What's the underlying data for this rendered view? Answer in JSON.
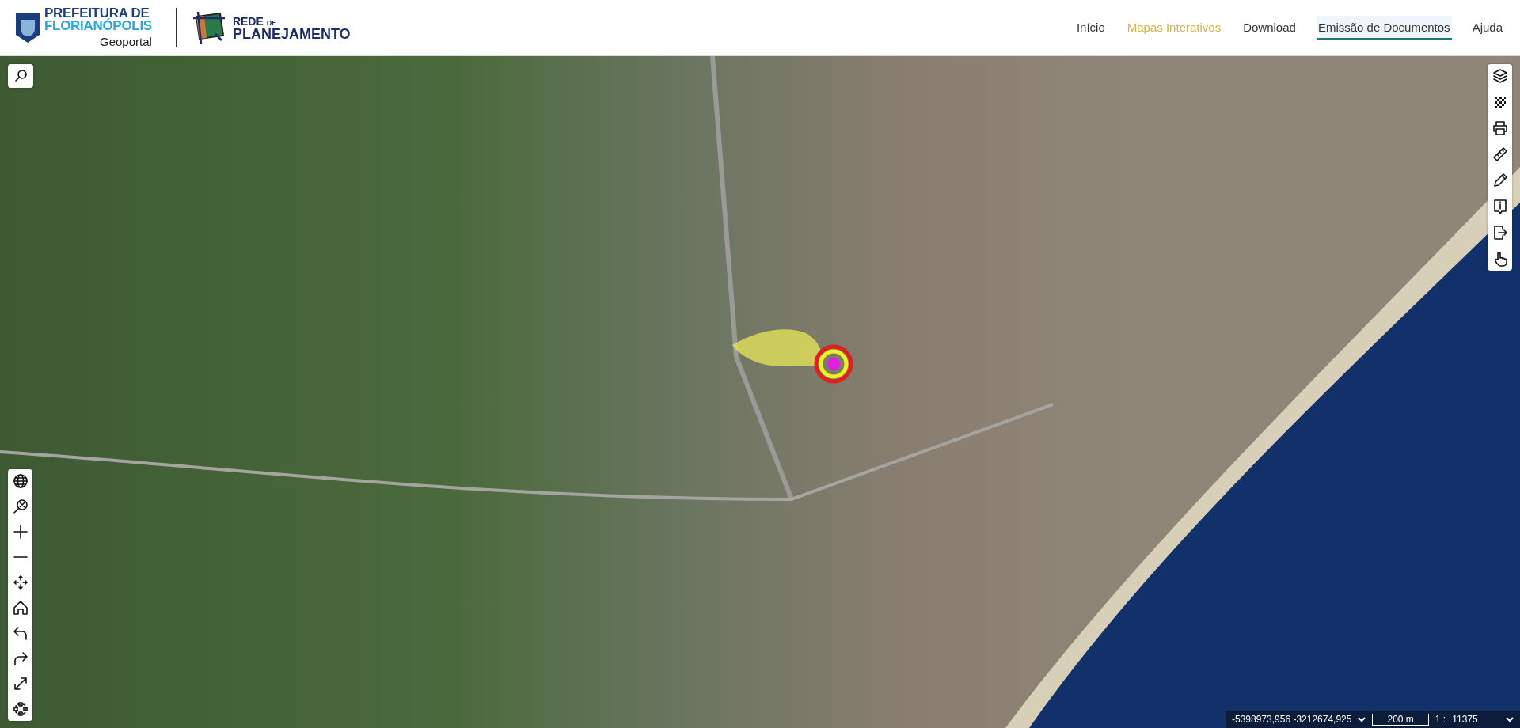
{
  "header": {
    "brand": {
      "line_1": "PREFEITURA DE",
      "line_2": "FLORIANÓPOLIS",
      "subtitle": "Geoportal"
    },
    "partner": {
      "line_1": "REDE",
      "line_1_small": "DE",
      "line_2": "PLANEJAMENTO"
    },
    "nav": [
      {
        "label": "Início",
        "selected": false,
        "highlighted": false
      },
      {
        "label": "Mapas Interativos",
        "selected": false,
        "highlighted": true
      },
      {
        "label": "Download",
        "selected": false,
        "highlighted": false
      },
      {
        "label": "Emissão de Documentos",
        "selected": true,
        "highlighted": false
      },
      {
        "label": "Ajuda",
        "selected": false,
        "highlighted": false
      }
    ]
  },
  "map": {
    "search_tool": {
      "kind": "search"
    },
    "left_tools": [
      {
        "kind": "globe"
      },
      {
        "kind": "zoom-extent"
      },
      {
        "kind": "zoom-in"
      },
      {
        "kind": "zoom-out"
      },
      {
        "kind": "pan"
      },
      {
        "kind": "home"
      },
      {
        "kind": "undo"
      },
      {
        "kind": "redo"
      },
      {
        "kind": "fullscreen"
      },
      {
        "kind": "select"
      }
    ],
    "right_tools": [
      {
        "kind": "layers"
      },
      {
        "kind": "basemap"
      },
      {
        "kind": "print"
      },
      {
        "kind": "measure"
      },
      {
        "kind": "draw"
      },
      {
        "kind": "info"
      },
      {
        "kind": "export"
      },
      {
        "kind": "pointer"
      }
    ],
    "status": {
      "coordinates": "-5398973,956 -3212674,925",
      "scale_bar": "200 m",
      "scale_prefix": "1 :",
      "scale_value": "11375"
    }
  }
}
